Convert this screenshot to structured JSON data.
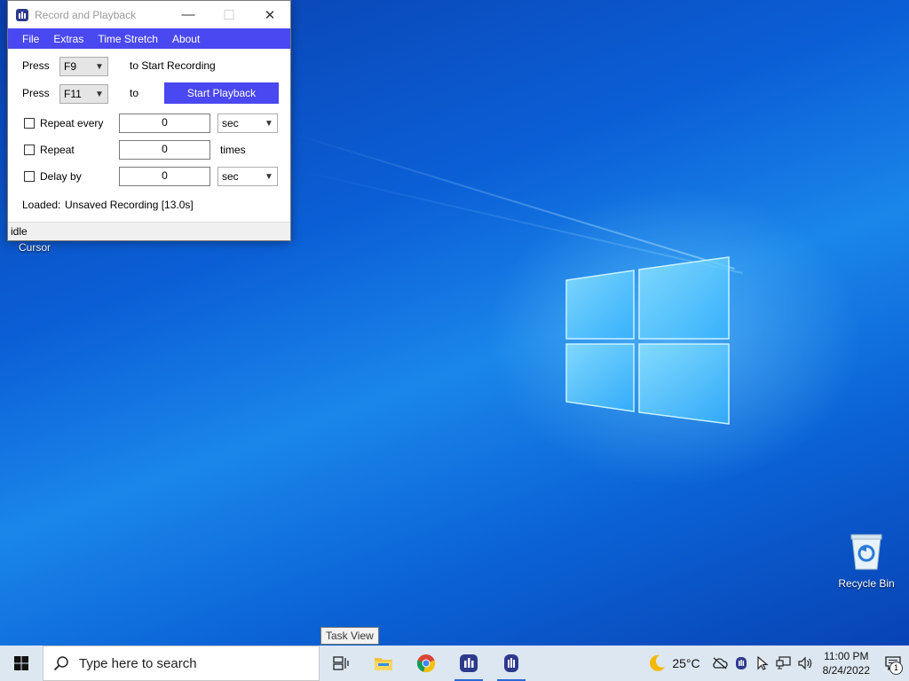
{
  "desktop": {
    "icons": [
      {
        "label": "Cursor"
      },
      {
        "label": "Recycle Bin"
      }
    ]
  },
  "window": {
    "title": "Record and Playback",
    "controls": {
      "minimize": "—",
      "maximize": "☐",
      "close": "✕"
    },
    "menu": [
      "File",
      "Extras",
      "Time Stretch",
      "About"
    ],
    "record_row": {
      "press_label": "Press",
      "hotkey": "F9",
      "suffix": "to Start Recording"
    },
    "playback_row": {
      "press_label": "Press",
      "hotkey": "F11",
      "to_label": "to",
      "button": "Start Playback"
    },
    "repeat_every": {
      "label": "Repeat every",
      "value": "0",
      "unit": "sec"
    },
    "repeat": {
      "label": "Repeat",
      "value": "0",
      "unit": "times"
    },
    "delay_by": {
      "label": "Delay by",
      "value": "0",
      "unit": "sec"
    },
    "loaded_label": "Loaded:",
    "loaded_value": "Unsaved Recording [13.0s]",
    "status": "idle"
  },
  "tooltip": "Task View",
  "taskbar": {
    "search_placeholder": "Type here to search",
    "temperature": "25°C",
    "time": "11:00 PM",
    "date": "8/24/2022",
    "notification_count": "1"
  },
  "colors": {
    "accent": "#4a48f0",
    "taskbar": "#dde7f2"
  }
}
